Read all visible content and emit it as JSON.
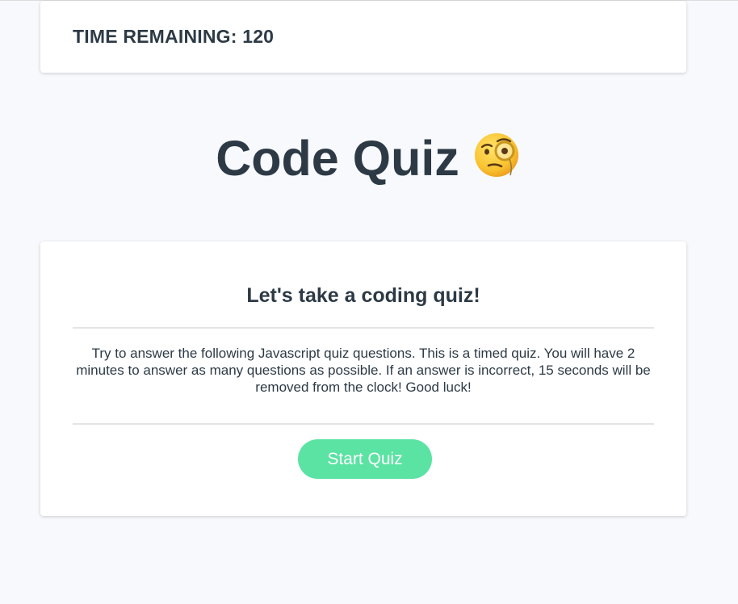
{
  "timer": {
    "label": "TIME REMAINING:",
    "value": "120"
  },
  "header": {
    "title": "Code Quiz",
    "title_icon": "face-with-monocle-icon"
  },
  "intro": {
    "heading": "Let's take a coding quiz!",
    "body": "Try to answer the following Javascript quiz questions. This is a timed quiz. You will have 2 minutes to answer as many questions as possible. If an answer is incorrect, 15 seconds will be removed from the clock! Good luck!",
    "start_button_label": "Start Quiz"
  },
  "colors": {
    "background": "#f7f9fc",
    "text": "#2d3a45",
    "accent": "#5ae3a3"
  }
}
